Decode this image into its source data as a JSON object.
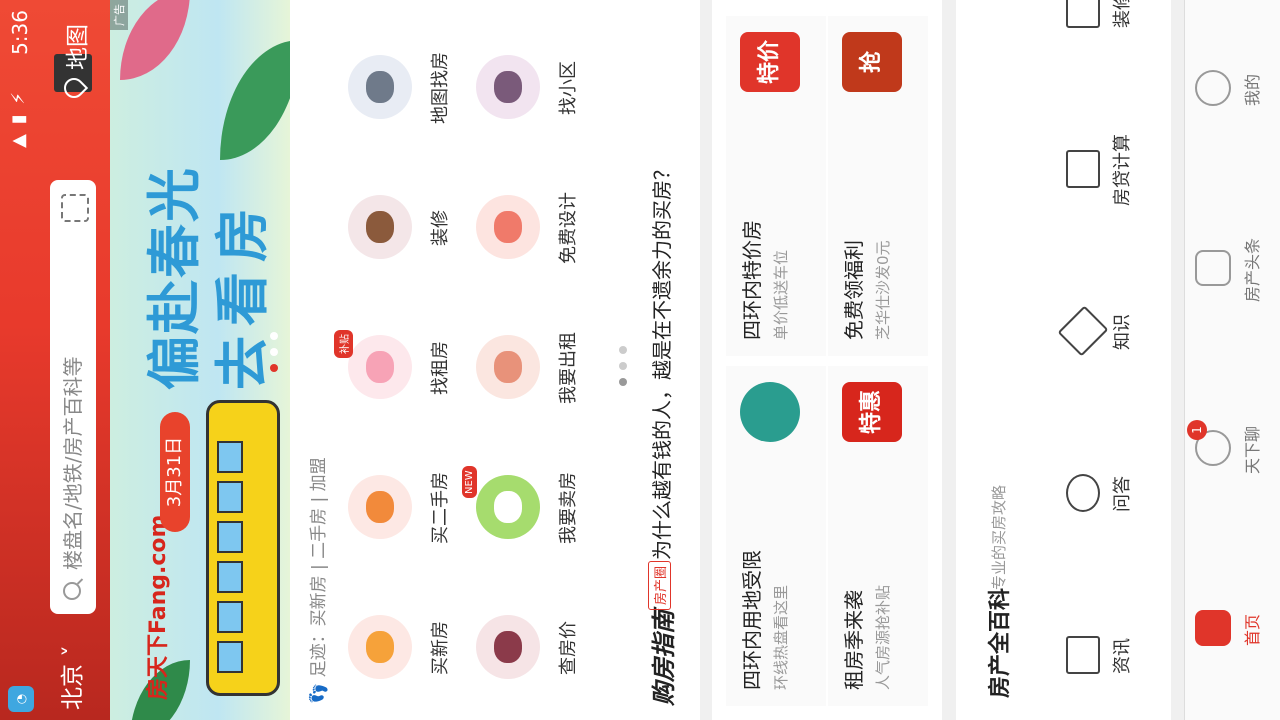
{
  "status": {
    "time": "5:36",
    "icons": "wifi signal battery"
  },
  "header": {
    "city": "北京 ˅",
    "search_placeholder": "楼盘名/地铁/房产百科等",
    "map_label": "地图"
  },
  "banner": {
    "logo": "房天下Fang.com",
    "date": "3月31日",
    "title": "偏赴春光",
    "subtitle": "去看房",
    "ad_tag": "广告",
    "colors": {
      "title": "#2e9ad6",
      "date": "#e8432c",
      "bus": "#f6d21a"
    }
  },
  "footprints": {
    "label": "足迹：",
    "items": "买新房 | 二手房 | 加盟"
  },
  "menu": [
    {
      "label": "买新房",
      "color": "#f6a23a",
      "icon": "tiger-icon"
    },
    {
      "label": "买二手房",
      "color": "#f28a3b",
      "icon": "tiger-icon"
    },
    {
      "label": "找租房",
      "color": "#f7a3b6",
      "icon": "pig-icon",
      "badge": "补贴"
    },
    {
      "label": "装修",
      "color": "#8b5a3c",
      "icon": "ox-icon"
    },
    {
      "label": "地图找房",
      "color": "#6f7a8a",
      "icon": "mouse-icon"
    },
    {
      "label": "查房价",
      "color": "#8b3a4a",
      "icon": "horse-icon"
    },
    {
      "label": "我要卖房",
      "color": "#ffffff",
      "icon": "rabbit-icon",
      "badge": "NEW"
    },
    {
      "label": "我要出租",
      "color": "#e8927a",
      "icon": "dog-icon"
    },
    {
      "label": "免费设计",
      "color": "#f07a6a",
      "icon": "sheep-icon"
    },
    {
      "label": "找小区",
      "color": "#7a5a7a",
      "icon": "snake-icon"
    }
  ],
  "guide": {
    "logo": "购房指南",
    "tag": "房产圈",
    "text": "为什么越有钱的人，越是在不遗余力的买房？"
  },
  "promos": [
    {
      "title": "四环内用地受限",
      "sub": "环线热盘看这里",
      "img_color": "#2a9d8f",
      "img_text": ""
    },
    {
      "title": "四环内特价房",
      "sub": "单价低送车位",
      "img_color": "#e0352a",
      "img_text": "特价"
    },
    {
      "title": "租房季来袭",
      "sub": "人气房源抢补贴",
      "img_color": "#d7261c",
      "img_text": "特惠"
    },
    {
      "title": "免费领福利",
      "sub": "芝华仕沙发0元",
      "img_color": "#c0391b",
      "img_text": "抢"
    }
  ],
  "encyclopedia": {
    "title": "房产全百科",
    "subtitle": "专业的买房攻略",
    "items": [
      {
        "label": "资讯",
        "icon": "news-icon"
      },
      {
        "label": "问答",
        "icon": "question-icon"
      },
      {
        "label": "知识",
        "icon": "cube-icon"
      },
      {
        "label": "房贷计算",
        "icon": "calculator-icon"
      },
      {
        "label": "装修",
        "icon": "decorate-icon"
      }
    ]
  },
  "tabbar": [
    {
      "label": "首页",
      "active": true,
      "icon": "home-icon"
    },
    {
      "label": "天下聊",
      "badge": "1",
      "icon": "chat-icon"
    },
    {
      "label": "房产头条",
      "icon": "headline-icon"
    },
    {
      "label": "我的",
      "icon": "user-icon"
    }
  ]
}
